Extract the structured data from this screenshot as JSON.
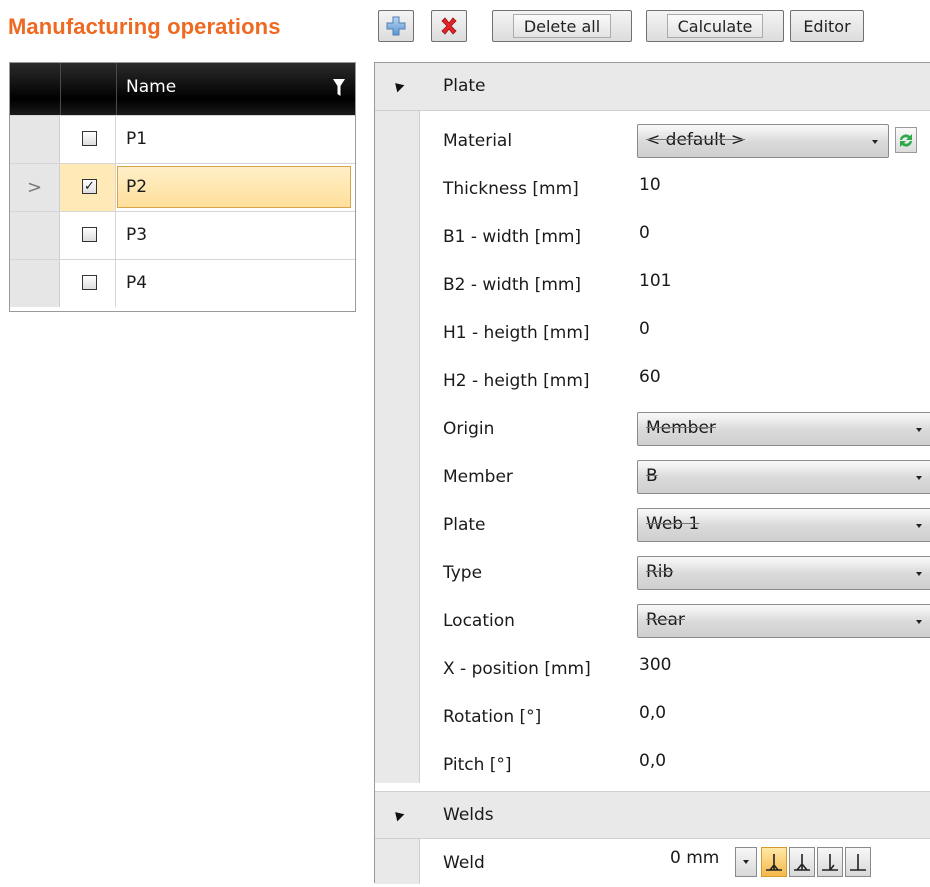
{
  "title": "Manufacturing operations",
  "toolbar": {
    "add_icon": "plus-icon",
    "delete_icon": "red-x-icon",
    "delete_all": "Delete all",
    "calculate": "Calculate",
    "editor": "Editor"
  },
  "grid": {
    "column_name": "Name",
    "filter_icon": "filter-icon",
    "rows": [
      {
        "label": "P1",
        "checked": false
      },
      {
        "label": "P2",
        "checked": true,
        "current_marker": ">"
      },
      {
        "label": "P3",
        "checked": false
      },
      {
        "label": "P4",
        "checked": false
      }
    ]
  },
  "panel": {
    "plate_section": "Plate",
    "welds_section": "Welds",
    "props": {
      "material": {
        "label": "Material",
        "value": "< default >"
      },
      "thickness": {
        "label": "Thickness [mm]",
        "value": "10"
      },
      "b1": {
        "label": "B1 - width [mm]",
        "value": "0"
      },
      "b2": {
        "label": "B2 - width [mm]",
        "value": "101"
      },
      "h1": {
        "label": "H1 - heigth [mm]",
        "value": "0"
      },
      "h2": {
        "label": "H2 - heigth [mm]",
        "value": "60"
      },
      "origin": {
        "label": "Origin",
        "value": "Member"
      },
      "member": {
        "label": "Member",
        "value": "B"
      },
      "plate": {
        "label": "Plate",
        "value": "Web 1"
      },
      "type": {
        "label": "Type",
        "value": "Rib"
      },
      "location": {
        "label": "Location",
        "value": "Rear"
      },
      "xpos": {
        "label": "X - position [mm]",
        "value": "300"
      },
      "rotation": {
        "label": "Rotation [°]",
        "value": "0,0"
      },
      "pitch": {
        "label": "Pitch [°]",
        "value": "0,0"
      },
      "weld": {
        "label": "Weld",
        "value": "0 mm"
      }
    }
  },
  "colors": {
    "title": "#ee6a22",
    "selection": "#ffdf9a",
    "header": "#000000"
  }
}
